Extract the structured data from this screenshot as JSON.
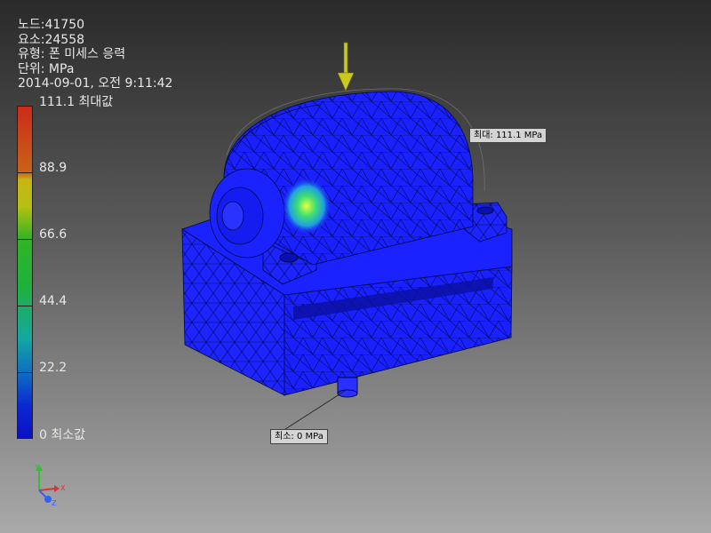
{
  "info": {
    "nodes": "노드:41750",
    "elements": "요소:24558",
    "type": "유형: 폰 미세스 응력",
    "units": "단위: MPa",
    "timestamp": "2014-09-01, 오전 9:11:42"
  },
  "legend": {
    "max_label": "111.1 최대값",
    "ticks": [
      "88.9",
      "66.6",
      "44.4",
      "22.2"
    ],
    "min_label": "0 최소값"
  },
  "callouts": {
    "max": "최대: 111.1 MPa",
    "min": "최소: 0 MPa"
  },
  "triad": {
    "x": "X",
    "y": "Y",
    "z": "Z"
  },
  "colors": {
    "mesh_body": "#1a20ff",
    "mesh_lines": "#000a40",
    "load_arrow": "#c8c81e",
    "hotspot": "#38e070"
  }
}
